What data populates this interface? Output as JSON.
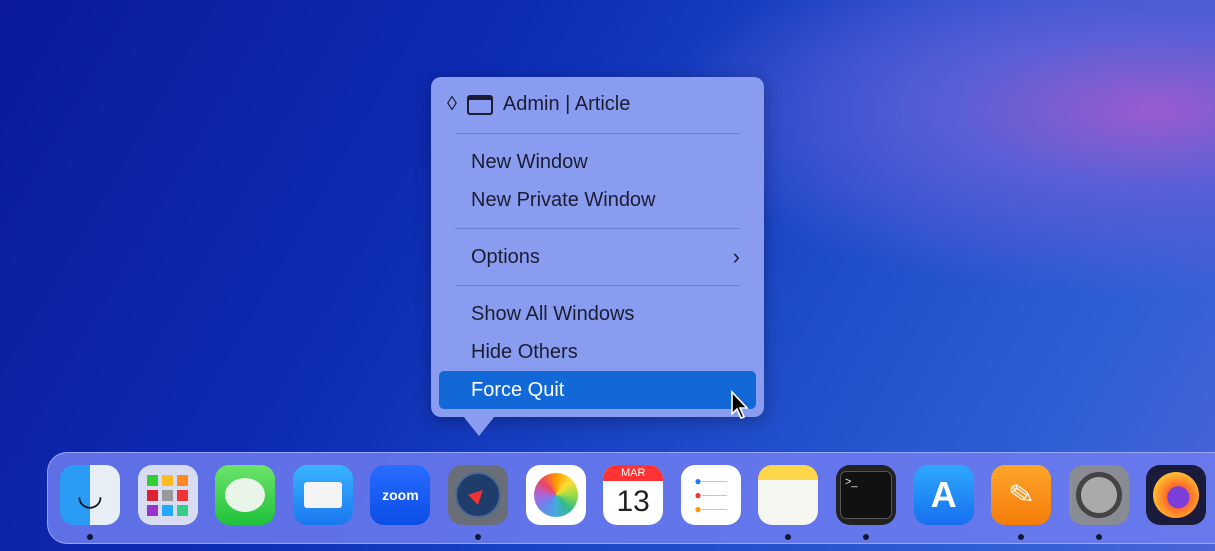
{
  "menu": {
    "title": "Admin | Article",
    "items": [
      "New Window",
      "New Private Window",
      "Options",
      "Show All Windows",
      "Hide Others",
      "Force Quit"
    ],
    "highlighted": "Force Quit"
  },
  "dock": {
    "apps": [
      {
        "name": "Finder",
        "running": true
      },
      {
        "name": "Launchpad",
        "running": false
      },
      {
        "name": "Messages",
        "running": false
      },
      {
        "name": "Mail",
        "running": false
      },
      {
        "name": "Zoom",
        "label": "zoom",
        "running": false
      },
      {
        "name": "Safari",
        "running": true
      },
      {
        "name": "Photos",
        "running": false
      },
      {
        "name": "Calendar",
        "month": "MAR",
        "day": "13",
        "running": false
      },
      {
        "name": "Reminders",
        "running": false
      },
      {
        "name": "Notes",
        "running": true
      },
      {
        "name": "Terminal",
        "running": true
      },
      {
        "name": "App Store",
        "running": false
      },
      {
        "name": "Pages",
        "running": true
      },
      {
        "name": "System Settings",
        "running": true
      },
      {
        "name": "Firefox",
        "running": false
      }
    ]
  }
}
